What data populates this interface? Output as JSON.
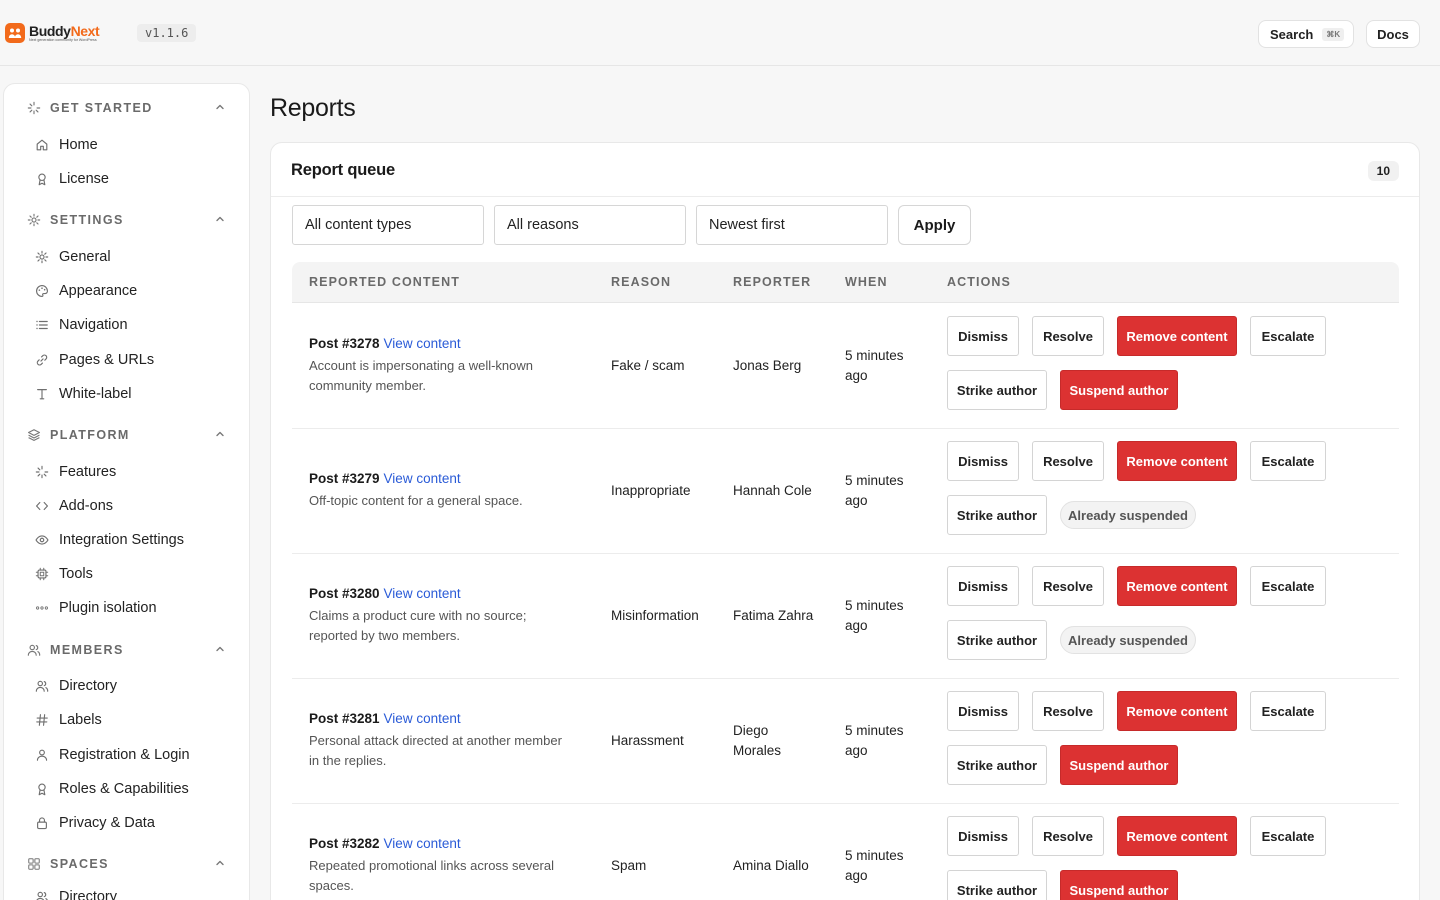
{
  "app": {
    "name_part1": "Buddy",
    "name_part2": "Next",
    "tagline": "Next generation community for WordPress",
    "version": "v1.1.6"
  },
  "topbar": {
    "search_label": "Search",
    "search_shortcut": "⌘K",
    "docs_label": "Docs"
  },
  "sidebar": {
    "sections": [
      {
        "title": "GET STARTED",
        "icon": "sparkles-icon",
        "items": [
          {
            "label": "Home",
            "icon": "home-icon"
          },
          {
            "label": "License",
            "icon": "award-icon"
          }
        ]
      },
      {
        "title": "SETTINGS",
        "icon": "gear-icon",
        "items": [
          {
            "label": "General",
            "icon": "gear-icon"
          },
          {
            "label": "Appearance",
            "icon": "palette-icon"
          },
          {
            "label": "Navigation",
            "icon": "list-icon"
          },
          {
            "label": "Pages & URLs",
            "icon": "link-icon"
          },
          {
            "label": "White-label",
            "icon": "type-icon"
          }
        ]
      },
      {
        "title": "PLATFORM",
        "icon": "layers-icon",
        "items": [
          {
            "label": "Features",
            "icon": "sparkles-icon"
          },
          {
            "label": "Add-ons",
            "icon": "code-icon"
          },
          {
            "label": "Integration Settings",
            "icon": "eye-icon"
          },
          {
            "label": "Tools",
            "icon": "cpu-icon"
          },
          {
            "label": "Plugin isolation",
            "icon": "dots-icon"
          }
        ]
      },
      {
        "title": "MEMBERS",
        "icon": "users-icon",
        "items": [
          {
            "label": "Directory",
            "icon": "users-icon"
          },
          {
            "label": "Labels",
            "icon": "hash-icon"
          },
          {
            "label": "Registration & Login",
            "icon": "user-icon"
          },
          {
            "label": "Roles & Capabilities",
            "icon": "award-icon"
          },
          {
            "label": "Privacy & Data",
            "icon": "lock-icon"
          }
        ]
      },
      {
        "title": "SPACES",
        "icon": "grid-icon",
        "items": [
          {
            "label": "Directory",
            "icon": "users-icon"
          }
        ]
      }
    ]
  },
  "page": {
    "title": "Reports"
  },
  "queue": {
    "title": "Report queue",
    "count": "10",
    "filters": {
      "content_type": "All content types",
      "reason": "All reasons",
      "sort": "Newest first",
      "apply_label": "Apply"
    },
    "columns": [
      "REPORTED CONTENT",
      "REASON",
      "REPORTER",
      "WHEN",
      "ACTIONS"
    ],
    "actions": {
      "dismiss": "Dismiss",
      "resolve": "Resolve",
      "remove": "Remove content",
      "escalate": "Escalate",
      "strike": "Strike author",
      "suspend": "Suspend author",
      "already_suspended": "Already suspended"
    },
    "rows": [
      {
        "post": "Post #3278",
        "link": "View content",
        "desc_lines": [
          "Account is impersonating a well-known",
          "community member."
        ],
        "reason": "Fake / scam",
        "reporter_lines": [
          "Jonas Berg"
        ],
        "when_lines": [
          "5 minutes",
          "ago"
        ],
        "suspended": false
      },
      {
        "post": "Post #3279",
        "link": "View content",
        "desc_lines": [
          "Off-topic content for a general space."
        ],
        "reason": "Inappropriate",
        "reporter_lines": [
          "Hannah Cole"
        ],
        "when_lines": [
          "5 minutes",
          "ago"
        ],
        "suspended": true
      },
      {
        "post": "Post #3280",
        "link": "View content",
        "desc_lines": [
          "Claims a product cure with no source;",
          "reported by two members."
        ],
        "reason": "Misinformation",
        "reporter_lines": [
          "Fatima Zahra"
        ],
        "when_lines": [
          "5 minutes",
          "ago"
        ],
        "suspended": true
      },
      {
        "post": "Post #3281",
        "link": "View content",
        "desc_lines": [
          "Personal attack directed at another member",
          "in the replies."
        ],
        "reason": "Harassment",
        "reporter_lines": [
          "Diego",
          "Morales"
        ],
        "when_lines": [
          "5 minutes",
          "ago"
        ],
        "suspended": false
      },
      {
        "post": "Post #3282",
        "link": "View content",
        "desc_lines": [
          "Repeated promotional links across several",
          "spaces."
        ],
        "reason": "Spam",
        "reporter_lines": [
          "Amina Diallo"
        ],
        "when_lines": [
          "5 minutes",
          "ago"
        ],
        "suspended": false
      }
    ]
  }
}
